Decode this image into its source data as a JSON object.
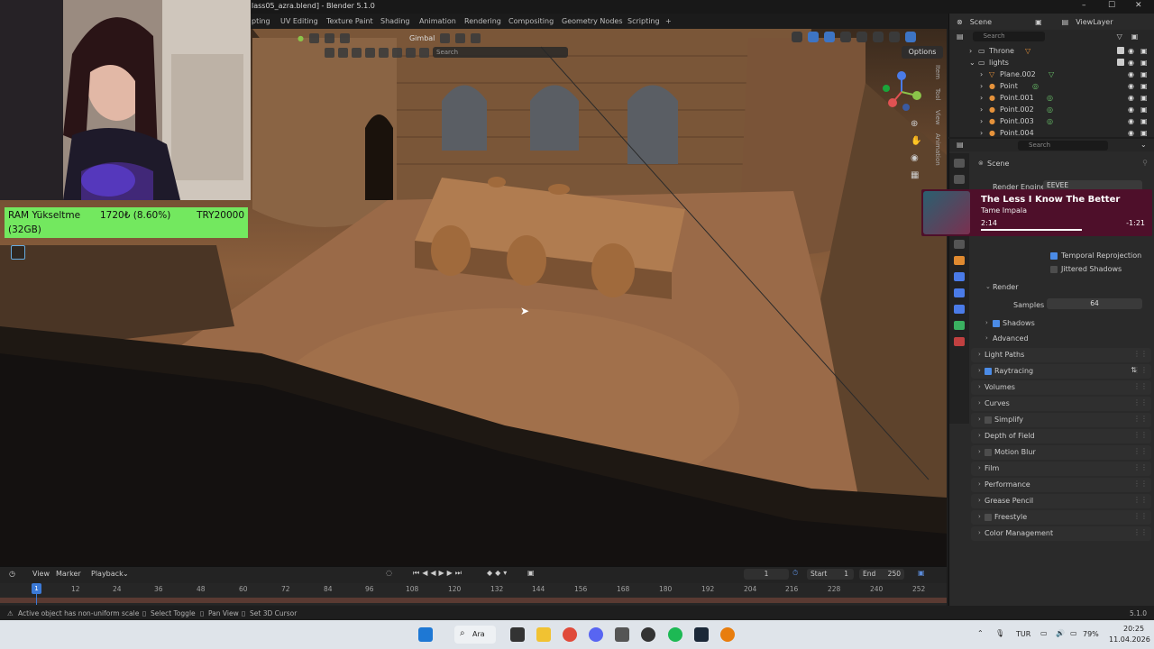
{
  "window": {
    "title": "lass05_azra.blend] - Blender 5.1.0"
  },
  "workspace_tabs": [
    "pting",
    "UV Editing",
    "Texture Paint",
    "Shading",
    "Animation",
    "Rendering",
    "Compositing",
    "Geometry Nodes",
    "Scripting",
    "+"
  ],
  "viewport": {
    "transform_orientation": "Gimbal",
    "search_placeholder": "Search",
    "options_label": "Options",
    "side_tabs": [
      "Item",
      "Tool",
      "View",
      "Animation"
    ]
  },
  "webcam": {
    "banner": {
      "product": "RAM Yükseltme",
      "price": "1720₺ (8.60%)",
      "goal": "TRY20000",
      "capacity": "(32GB)"
    }
  },
  "timeline": {
    "menus": [
      "View",
      "Marker",
      "Playback"
    ],
    "current_frame": "1",
    "start_label": "Start",
    "start_value": "1",
    "end_label": "End",
    "end_value": "250",
    "playhead_frame": "1",
    "ticks": [
      "12",
      "24",
      "36",
      "48",
      "60",
      "72",
      "84",
      "96",
      "108",
      "120",
      "132",
      "144",
      "156",
      "168",
      "180",
      "192",
      "204",
      "216",
      "228",
      "240",
      "252"
    ]
  },
  "statusbar": {
    "warning": "Active object has non-uniform scale",
    "hint1": "Select Toggle",
    "hint2": "Pan View",
    "hint3": "Set 3D Cursor",
    "version": "5.1.0"
  },
  "outliner": {
    "scene_label": "Scene",
    "view_layer": "ViewLayer",
    "search_placeholder": "Search",
    "rows": [
      {
        "label": "Throne",
        "indent": 0
      },
      {
        "label": "lights",
        "indent": 0
      },
      {
        "label": "Plane.002",
        "indent": 1
      },
      {
        "label": "Point",
        "indent": 1
      },
      {
        "label": "Point.001",
        "indent": 1
      },
      {
        "label": "Point.002",
        "indent": 1
      },
      {
        "label": "Point.003",
        "indent": 1
      },
      {
        "label": "Point.004",
        "indent": 1
      }
    ]
  },
  "properties": {
    "search_placeholder": "Search",
    "context": "Scene",
    "render_engine_label": "Render Engine",
    "render_engine_value": "EEVEE",
    "temporal_reprojection": "Temporal Reprojection",
    "jittered_shadows": "Jittered Shadows",
    "render_panel": "Render",
    "samples_label": "Samples",
    "samples_value": "64",
    "shadows": "Shadows",
    "advanced": "Advanced",
    "panels": [
      "Light Paths",
      "Raytracing",
      "Volumes",
      "Curves",
      "Simplify",
      "Depth of Field",
      "Motion Blur",
      "Film",
      "Performance",
      "Grease Pencil",
      "Freestyle",
      "Color Management"
    ]
  },
  "music": {
    "song": "The Less I Know The Better",
    "artist": "Tame Impala",
    "elapsed": "2:14",
    "remaining": "-1:21",
    "progress": 0.62
  },
  "taskbar": {
    "search_label": "Ara",
    "language": "TUR",
    "battery": "79%",
    "time": "20:25",
    "date": "11.04.2026"
  }
}
